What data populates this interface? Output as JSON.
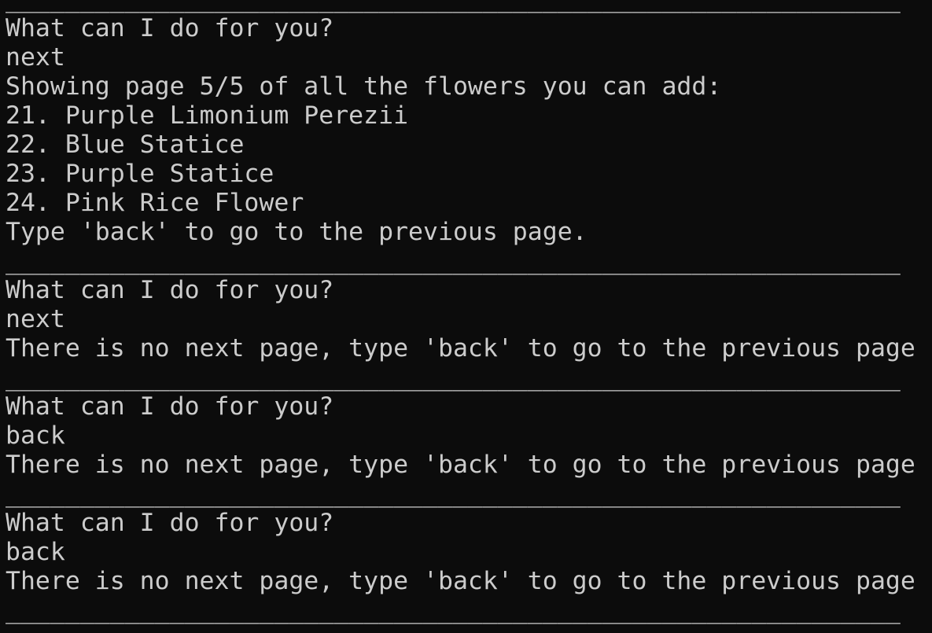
{
  "terminal": {
    "separator": "____________________________________________________________",
    "blocks": [
      {
        "prompt": "What can I do for you?",
        "input": "next",
        "output": [
          "Showing page 5/5 of all the flowers you can add:",
          "21. Purple Limonium Perezii",
          "22. Blue Statice",
          "23. Purple Statice",
          "24. Pink Rice Flower",
          "Type 'back' to go to the previous page."
        ]
      },
      {
        "prompt": "What can I do for you?",
        "input": "next",
        "output": [
          "There is no next page, type 'back' to go to the previous page"
        ]
      },
      {
        "prompt": "What can I do for you?",
        "input": "back",
        "output": [
          "There is no next page, type 'back' to go to the previous page"
        ]
      },
      {
        "prompt": "What can I do for you?",
        "input": "back",
        "output": [
          "There is no next page, type 'back' to go to the previous page"
        ]
      }
    ]
  },
  "colors": {
    "background": "#0c0c0c",
    "text": "#cccccc"
  }
}
